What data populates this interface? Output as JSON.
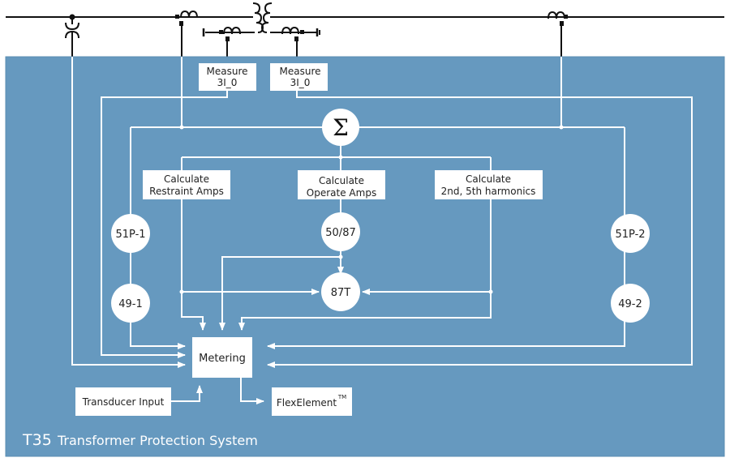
{
  "colors": {
    "panel": "#6699bf",
    "panel_border": "#5a8cb2",
    "wire": "#ffffff",
    "line": "#111111",
    "text": "#222222"
  },
  "title": {
    "model": "T35",
    "name": "Transformer Protection System"
  },
  "measure_boxes": [
    {
      "line1": "Measure",
      "line2": "3I_0"
    },
    {
      "line1": "Measure",
      "line2": "3I_0"
    }
  ],
  "summation": {
    "symbol": "Σ"
  },
  "calc_boxes": {
    "restraint": {
      "line1": "Calculate",
      "line2": "Restraint Amps"
    },
    "operate": {
      "line1": "Calculate",
      "line2": "Operate Amps"
    },
    "harmonics": {
      "line1": "Calculate",
      "line2": "2nd, 5th harmonics"
    }
  },
  "elements": {
    "p51_1": "51P-1",
    "t49_1": "49-1",
    "e50_87": "50/87",
    "e87t": "87T",
    "p51_2": "51P-2",
    "t49_2": "49-2"
  },
  "metering": "Metering",
  "transducer": "Transducer Input",
  "flexelement": {
    "label": "FlexElement",
    "mark": "TM"
  }
}
